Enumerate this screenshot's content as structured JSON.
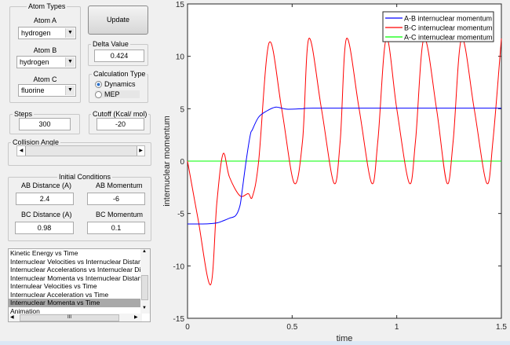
{
  "atom_types": {
    "title": "Atom Types",
    "atom_a_label": "Atom A",
    "atom_a": "hydrogen",
    "atom_b_label": "Atom B",
    "atom_b": "hydrogen",
    "atom_c_label": "Atom C",
    "atom_c": "fluorine"
  },
  "update_label": "Update",
  "delta": {
    "title": "Delta Value",
    "value": "0.424"
  },
  "calc_type": {
    "title": "Calculation Type",
    "options": [
      "Dynamics",
      "MEP"
    ],
    "selected": "Dynamics"
  },
  "steps": {
    "title": "Steps",
    "value": "300"
  },
  "cutoff": {
    "title": "Cutoff (Kcal/ mol)",
    "value": "-20"
  },
  "collision_angle": {
    "title": "Collision Angle",
    "slider_fraction": 0
  },
  "initial": {
    "title": "Initial Conditions",
    "ab_dist_label": "AB Distance (A)",
    "ab_dist": "2.4",
    "ab_mom_label": "AB Momentum",
    "ab_mom": "-6",
    "bc_dist_label": "BC Distance (A)",
    "bc_dist": "0.98",
    "bc_mom_label": "BC Momentum",
    "bc_mom": "0.1"
  },
  "plot_list": {
    "items": [
      "Kinetic Energy vs Time",
      "Internuclear Velocities vs Internuclear Distance",
      "Internuclear Accelerations vs Internuclear Dista",
      "Internuclear Momenta vs Internuclear Distance",
      "Internulear Velocities vs Time",
      "Internuclear Acceleration vs Time",
      "Internuclear Momenta vs Time",
      "Animation"
    ],
    "selected_index": 6,
    "hscroll_glyph": "III"
  },
  "chart_data": {
    "type": "line",
    "xlabel": "time",
    "ylabel": "internuclear momentum",
    "xlim": [
      0,
      1.5
    ],
    "ylim": [
      -15,
      15
    ],
    "xticks": [
      "0",
      "0.5",
      "1",
      "1.5"
    ],
    "yticks": [
      "15",
      "10",
      "5",
      "0",
      "-5",
      "-10",
      "-15"
    ],
    "legend_position": "top-right",
    "series": [
      {
        "name": "A-B internuclear momentum",
        "color": "#0000ff",
        "x": [
          0,
          0.05,
          0.1,
          0.14,
          0.17,
          0.2,
          0.23,
          0.25,
          0.26,
          0.28,
          0.3,
          0.31,
          0.34,
          0.38,
          0.42,
          0.45,
          0.48,
          0.55,
          0.6,
          1.0,
          1.5
        ],
        "y": [
          -6,
          -6,
          -5.98,
          -5.9,
          -5.7,
          -5.45,
          -5.2,
          -4.3,
          -3,
          0,
          2.5,
          3,
          4.2,
          4.8,
          5.15,
          5.05,
          4.95,
          5.0,
          5.05,
          5.05,
          5.05
        ]
      },
      {
        "name": "B-C internuclear momentum",
        "color": "#ff0000",
        "x": [
          0,
          0.05,
          0.11,
          0.14,
          0.17,
          0.2,
          0.25,
          0.29,
          0.31,
          0.34,
          0.39,
          0.45,
          0.51,
          0.55,
          0.58,
          0.64,
          0.7,
          0.73,
          0.76,
          0.82,
          0.88,
          0.91,
          0.95,
          1.0,
          1.06,
          1.09,
          1.13,
          1.19,
          1.24,
          1.27,
          1.31,
          1.37,
          1.43,
          1.46,
          1.5
        ],
        "y": [
          0,
          -5.5,
          -11.8,
          -4,
          0.7,
          -1.5,
          -3.3,
          -3.1,
          -3.4,
          0,
          11.3,
          5,
          -2.1,
          2,
          11.7,
          5,
          -2.1,
          2,
          11.7,
          5,
          -2.1,
          2,
          11.7,
          5,
          -2.1,
          2,
          11.7,
          5,
          -2.1,
          2,
          11.7,
          5,
          -2.1,
          2,
          11.7
        ]
      },
      {
        "name": "A-C internuclear momentum",
        "color": "#00ff00",
        "x": [
          0,
          1.5
        ],
        "y": [
          0,
          0
        ]
      }
    ]
  }
}
